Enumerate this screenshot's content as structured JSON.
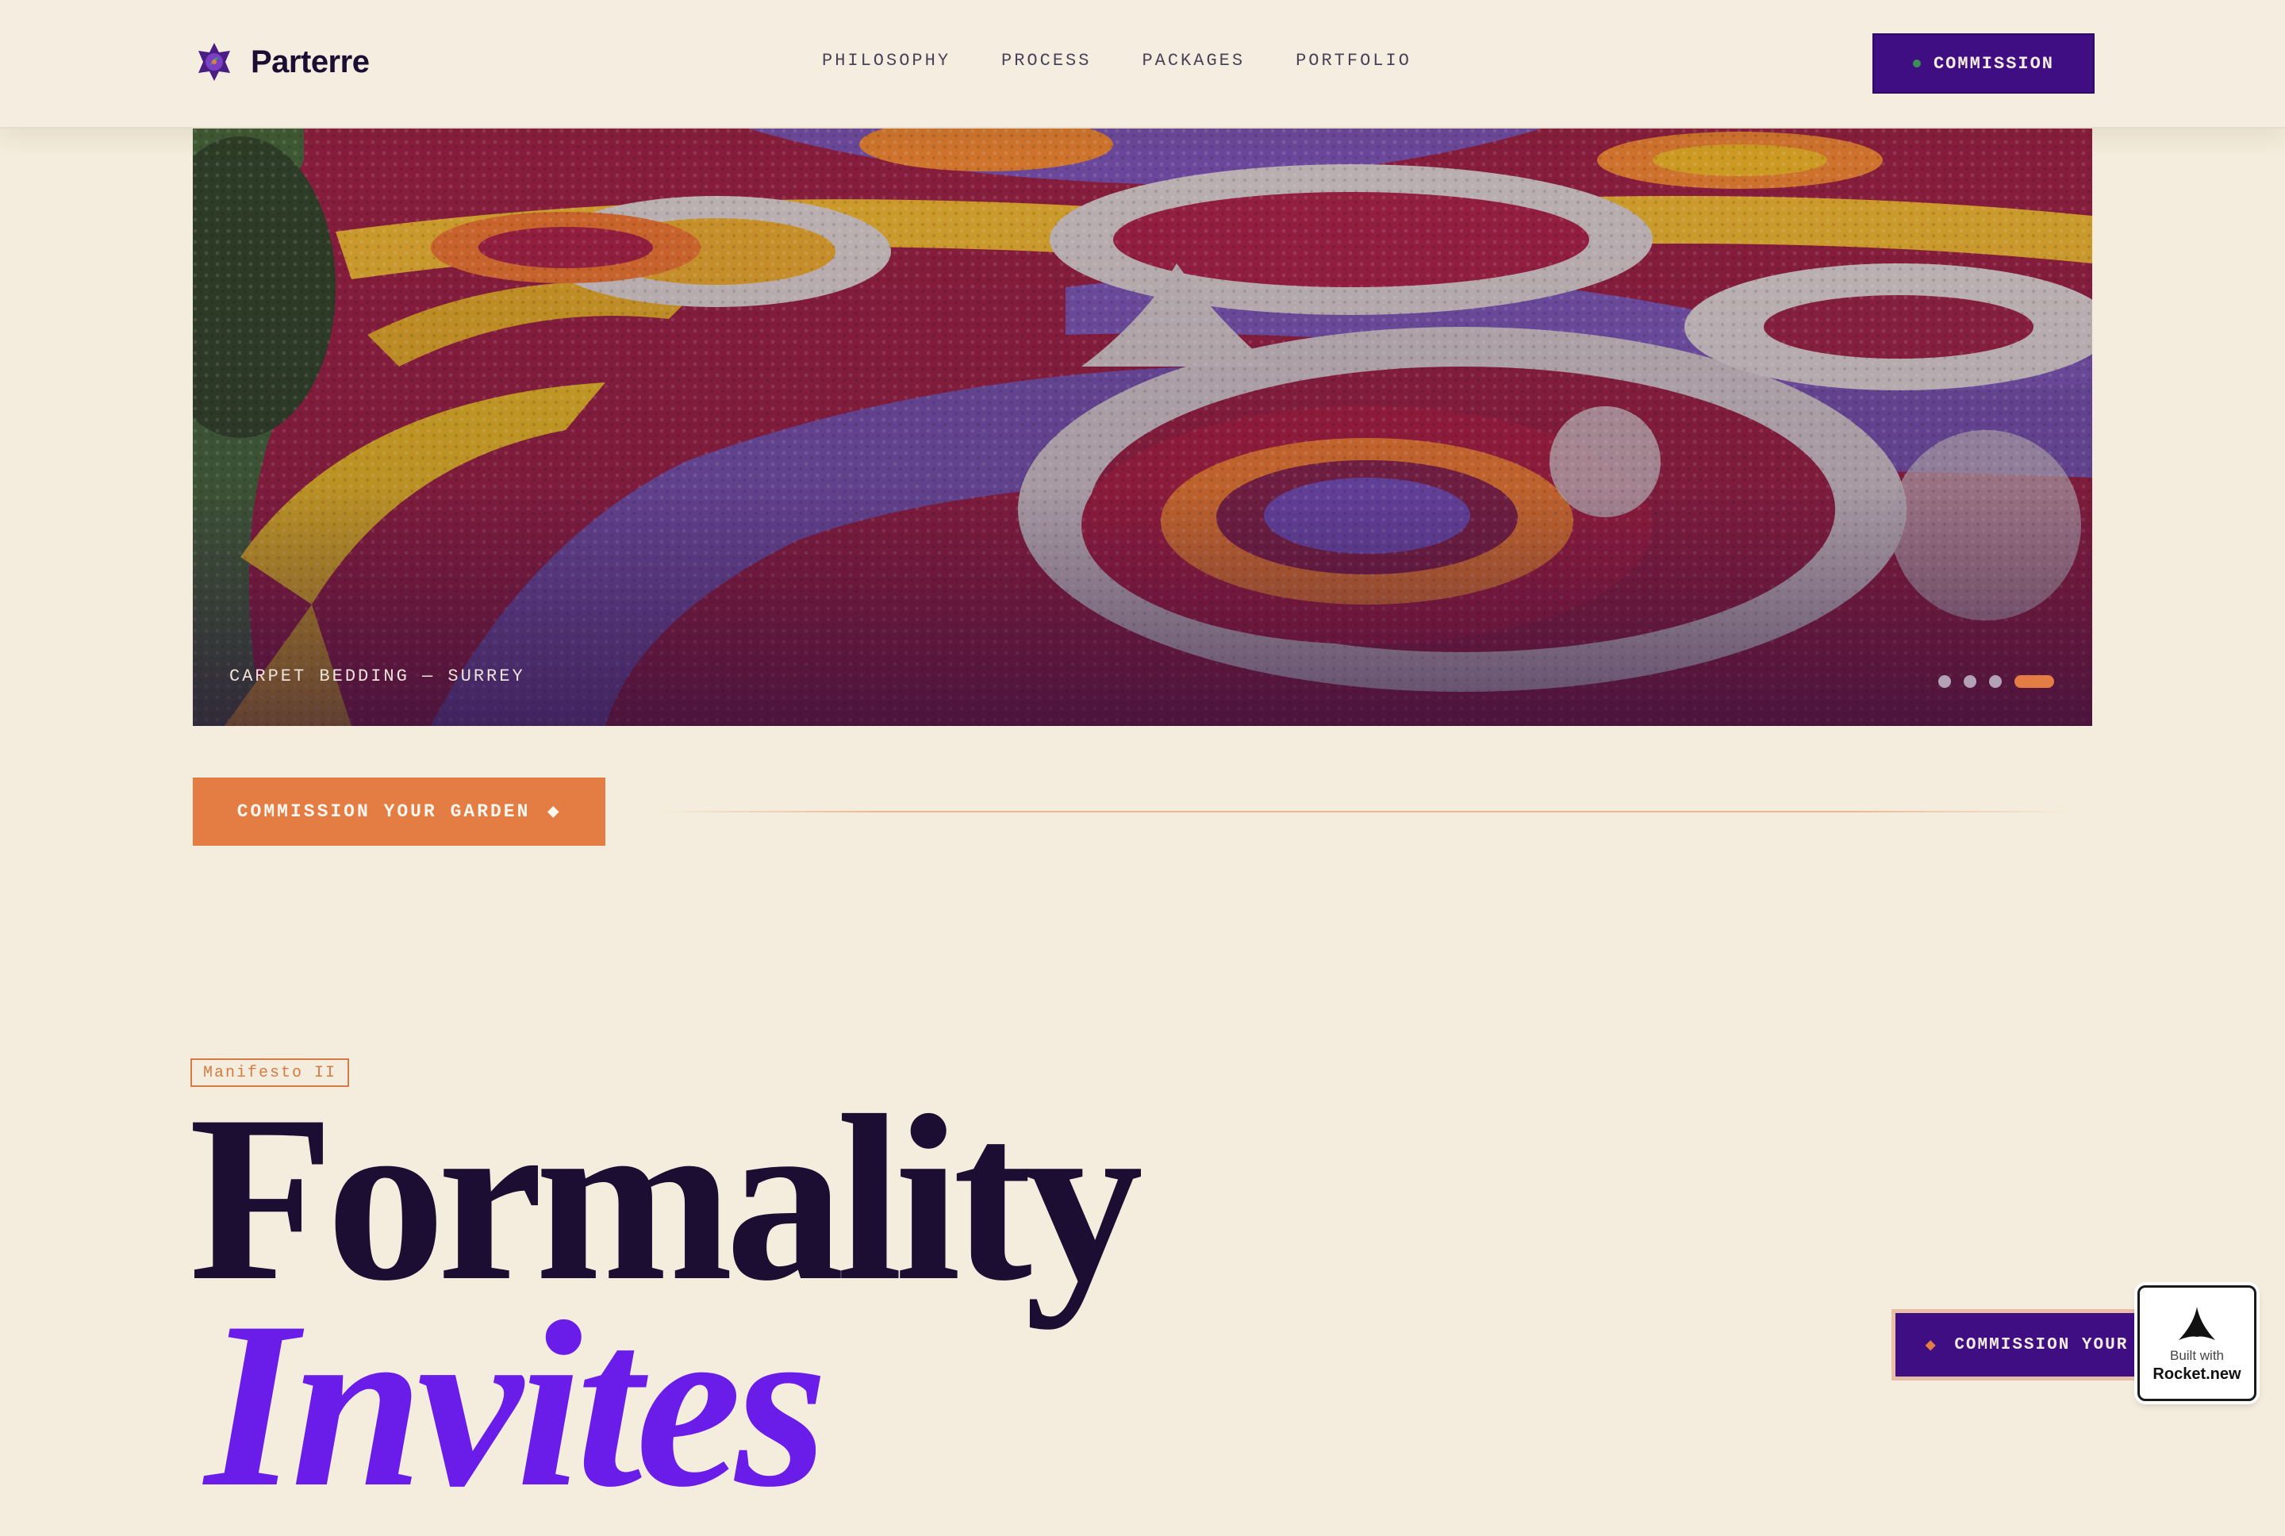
{
  "header": {
    "brand_name": "Parterre",
    "nav": [
      "PHILOSOPHY",
      "PROCESS",
      "PACKAGES",
      "PORTFOLIO"
    ],
    "cta_label": "COMMISSION"
  },
  "hero": {
    "caption": "CARPET BEDDING — SURREY",
    "slides_count": 4,
    "active_slide": 4
  },
  "commission_row": {
    "cta_label": "COMMISSION YOUR GARDEN",
    "cta_icon": "◆"
  },
  "manifesto": {
    "tag": "Manifesto II",
    "headline_line1": "Formality",
    "headline_line2": "Invites"
  },
  "floating": {
    "cta_label": "COMMISSION YOUR GARDEN",
    "cta_icon": "◆",
    "badge_line1": "Built with",
    "badge_line2": "Rocket.new"
  },
  "colors": {
    "background": "#f4ecdc",
    "ink": "#1c0d33",
    "purple": "#3f0e83",
    "violet": "#6a1de8",
    "orange": "#e37d43"
  }
}
